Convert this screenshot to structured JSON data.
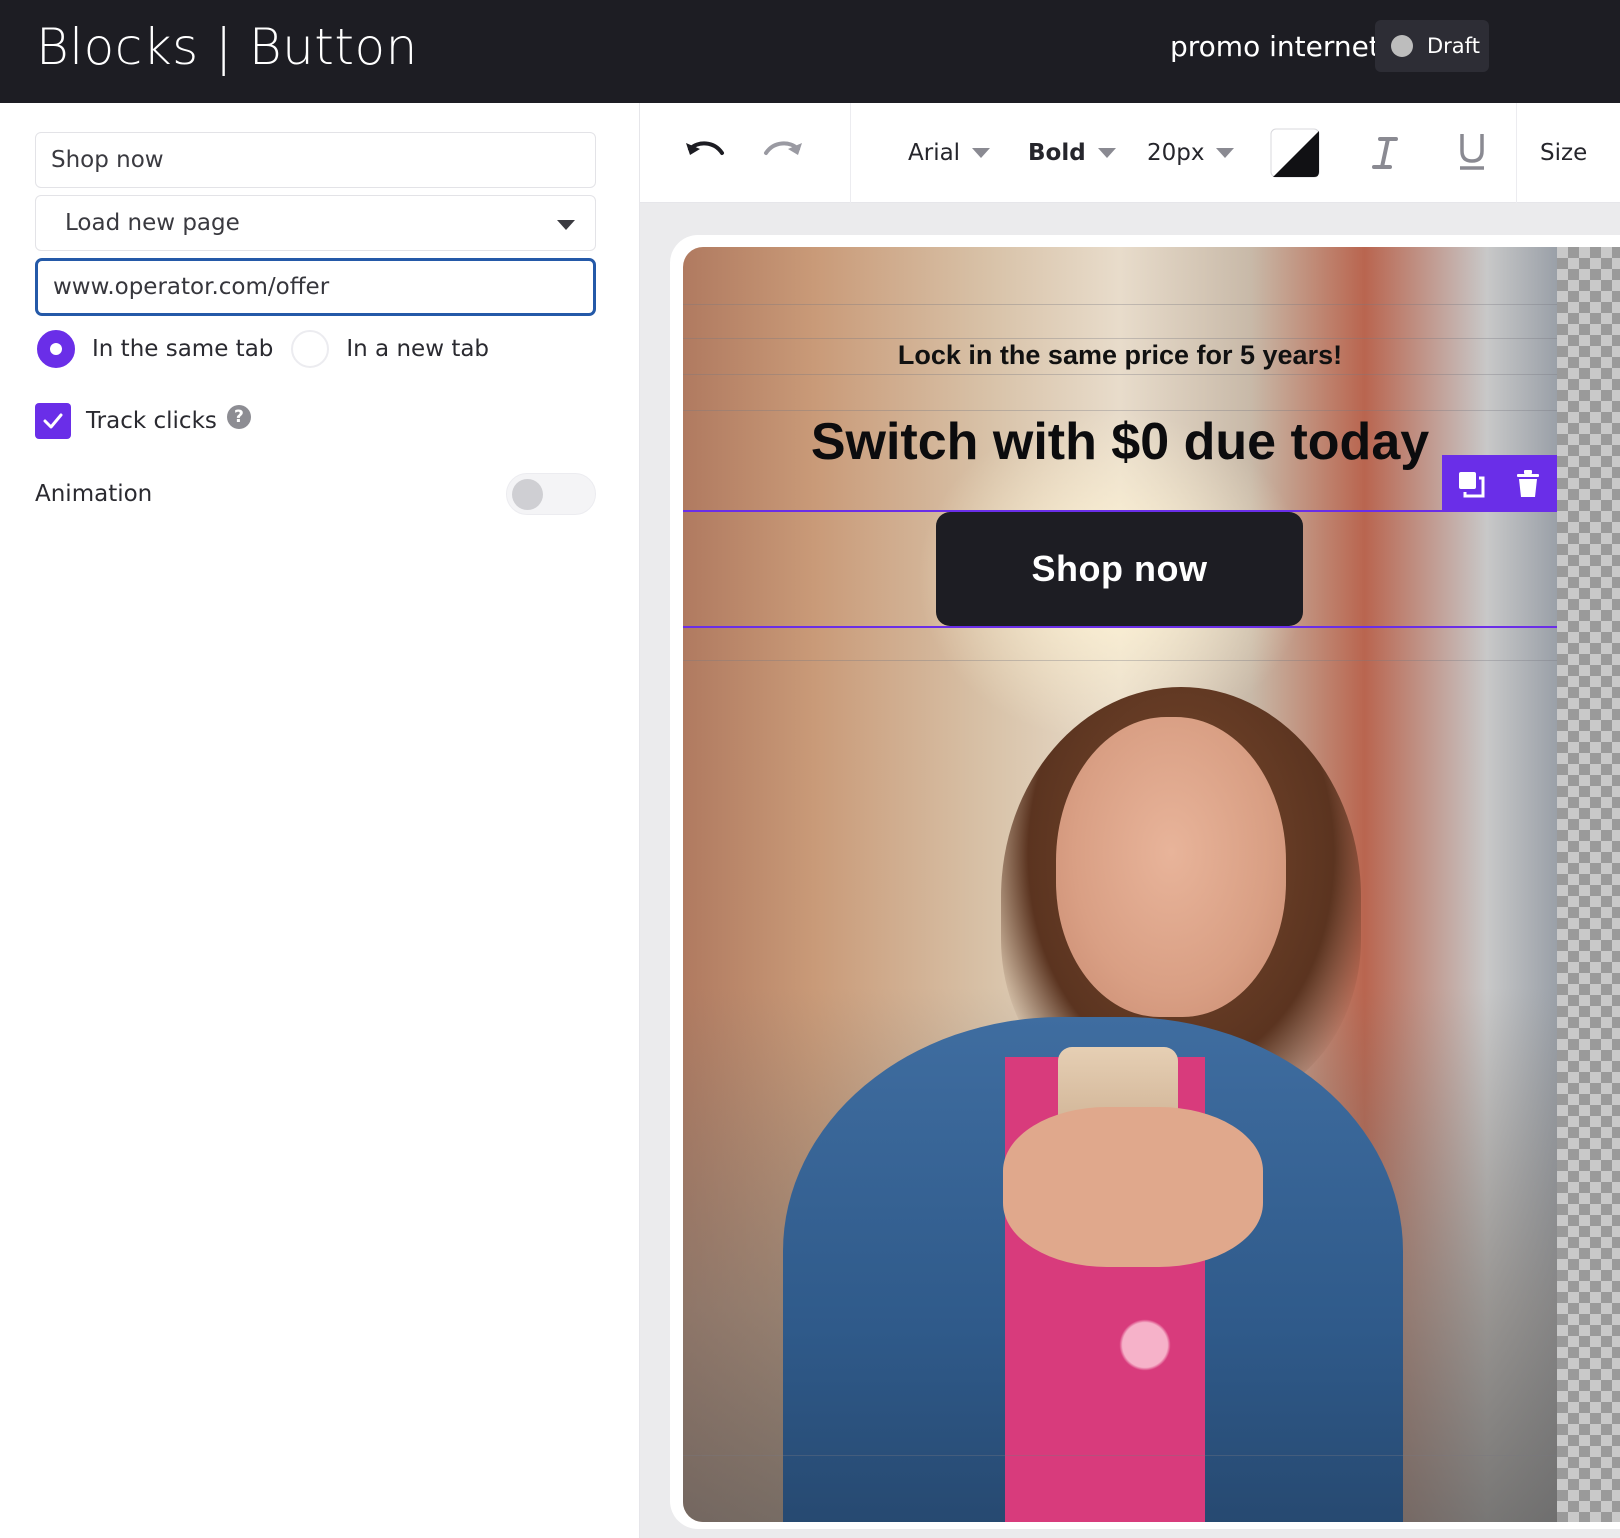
{
  "header": {
    "title": "Blocks | Button",
    "project_name": "promo internet",
    "status": "Draft"
  },
  "panel": {
    "button_text": "Shop now",
    "action": "Load new page",
    "url": "www.operator.com/offer",
    "target_options": [
      {
        "label": "In the same tab",
        "selected": true
      },
      {
        "label": "In a new tab",
        "selected": false
      }
    ],
    "track_clicks": {
      "label": "Track clicks",
      "checked": true
    },
    "animation": {
      "label": "Animation",
      "enabled": false
    }
  },
  "toolbar": {
    "font": "Arial",
    "weight": "Bold",
    "size": "20px",
    "size_menu": "Size"
  },
  "canvas": {
    "subheadline": "Lock in the same price for 5 years!",
    "headline": "Switch with $0 due today",
    "button_label": "Shop now"
  },
  "colors": {
    "accent": "#6a2ee8",
    "header_bg": "#1d1d23",
    "url_focus_border": "#2459a8"
  }
}
